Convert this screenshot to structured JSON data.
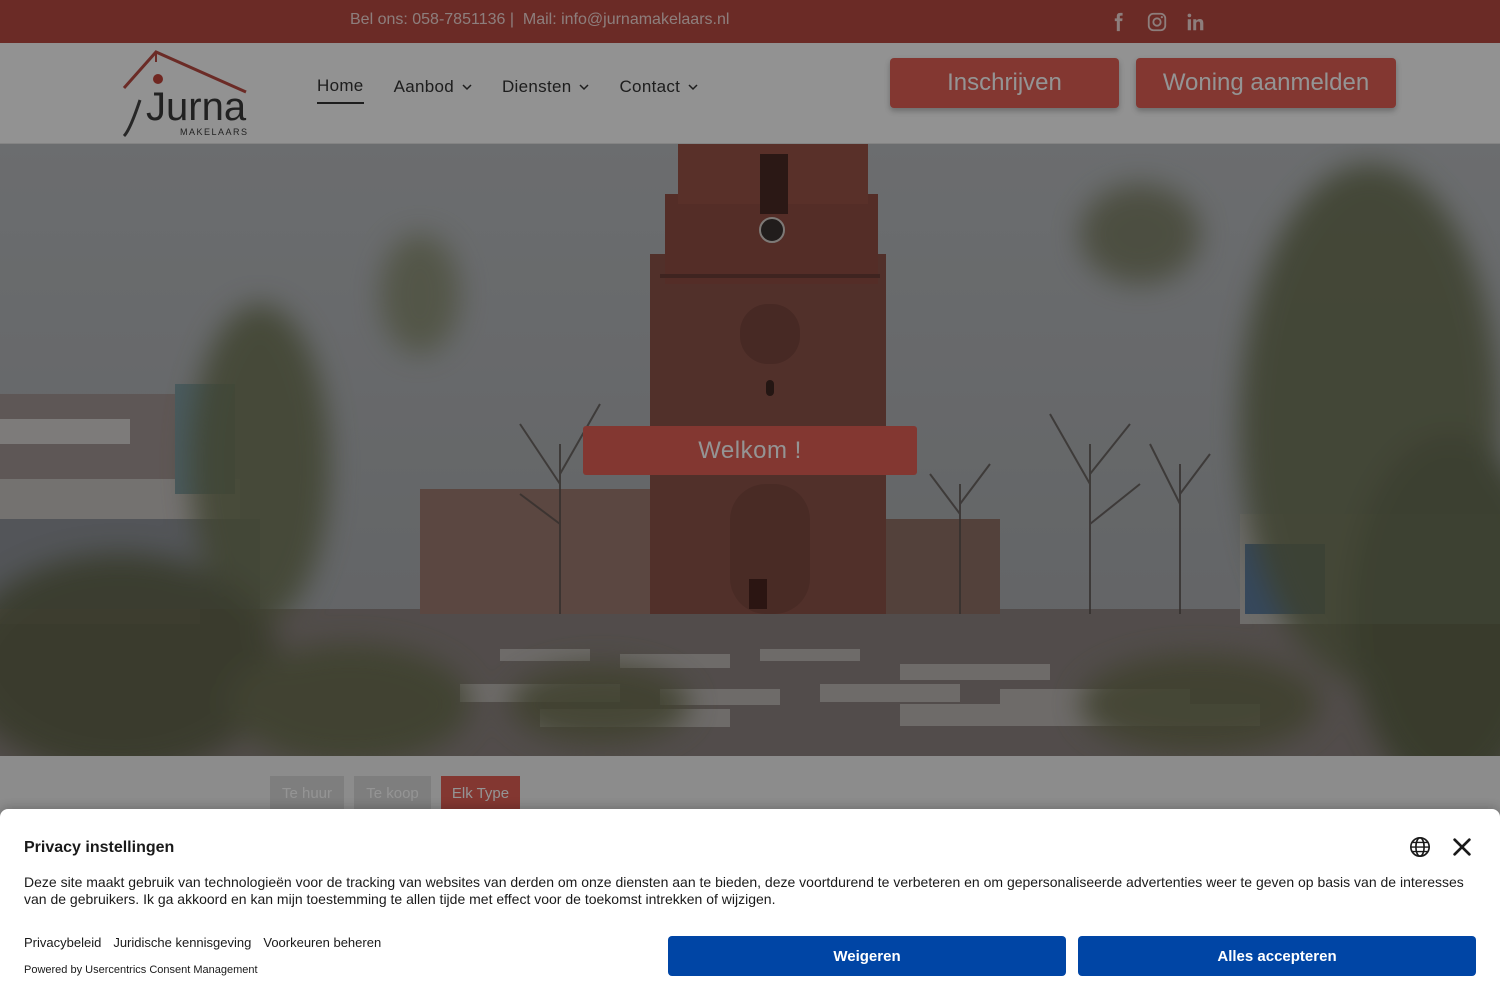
{
  "topbar": {
    "phone": "Bel ons: 058-7851136 |",
    "mail": "Mail: info@jurnamakelaars.nl",
    "socials": [
      "facebook-icon",
      "instagram-icon",
      "linkedin-icon"
    ]
  },
  "header": {
    "logo_text": "Jurna",
    "logo_sub": "MAKELAARS",
    "nav": [
      {
        "label": "Home",
        "active": true
      },
      {
        "label": "Aanbod",
        "dropdown": true
      },
      {
        "label": "Diensten",
        "dropdown": true
      },
      {
        "label": "Contact",
        "dropdown": true
      }
    ],
    "buttons": {
      "signup": "Inschrijven",
      "register_home": "Woning aanmelden"
    }
  },
  "hero": {
    "welcome": "Welkom !"
  },
  "filters": {
    "chips": [
      "Te huur",
      "Te koop",
      "Elk Type"
    ],
    "selected": "Elk Type"
  },
  "consent": {
    "title": "Privacy instellingen",
    "description": "Deze site maakt gebruik van technologieën voor de tracking van websites van derden om onze diensten aan te bieden, deze voortdurend te verbeteren en om gepersonaliseerde advertenties weer te geven op basis van de interesses van de gebruikers. Ik ga akkoord en kan mijn toestemming te allen tijde met effect voor de toekomst intrekken of wijzigen.",
    "links": [
      "Privacybeleid",
      "Juridische kennisgeving",
      "Voorkeuren beheren"
    ],
    "powered": "Powered by Usercentrics Consent Management",
    "reject": "Weigeren",
    "accept": "Alles accepteren"
  },
  "colors": {
    "brand_red": "#e25f55",
    "topbar_red": "#b94a42",
    "consent_blue": "#0045a5"
  }
}
